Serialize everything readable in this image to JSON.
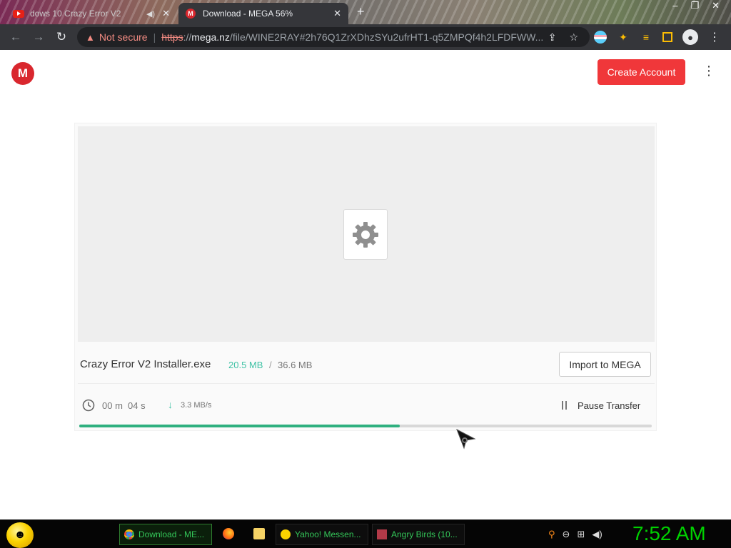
{
  "browser": {
    "tabs": [
      {
        "title": "dows 10 Crazy Error V2",
        "active": false
      },
      {
        "title": "Download - MEGA 56%",
        "active": true
      }
    ],
    "new_tab": "+",
    "address": {
      "security_label": "Not secure",
      "url_scheme": "https",
      "url_scheme_sep": "://",
      "url_host": "mega.nz",
      "url_path": "/file/WINE2RAY#2h76Q1ZrXDhzSYu2ufrHT1-q5ZMPQf4h2LFDFWW..."
    },
    "colors": {
      "chrome_dark": "#35363a",
      "warning": "#f28b82"
    }
  },
  "mega": {
    "logo_letter": "M",
    "create_account_label": "Create Account",
    "file": {
      "name": "Crazy Error V2 Installer.exe",
      "downloaded": "20.5 MB",
      "separator": "/",
      "total": "36.6 MB",
      "import_label": "Import to MEGA",
      "time_minutes": "00 m",
      "time_seconds": "04 s",
      "speed": "3.3 MB/s",
      "pause_label": "Pause Transfer",
      "progress_fraction": 0.56
    },
    "colors": {
      "brand_red": "#d9272e",
      "button_red": "#f0373a",
      "accent_teal": "#3fc2a5",
      "progress_green": "#2fb07f"
    }
  },
  "taskbar": {
    "items": [
      {
        "label": "Download - ME..."
      },
      {
        "label": "Yahoo! Messen..."
      },
      {
        "label": "Angry Birds (10..."
      }
    ],
    "clock": "7:52 AM",
    "colors": {
      "text_green": "#34c759",
      "clock_green": "#00d000"
    }
  }
}
